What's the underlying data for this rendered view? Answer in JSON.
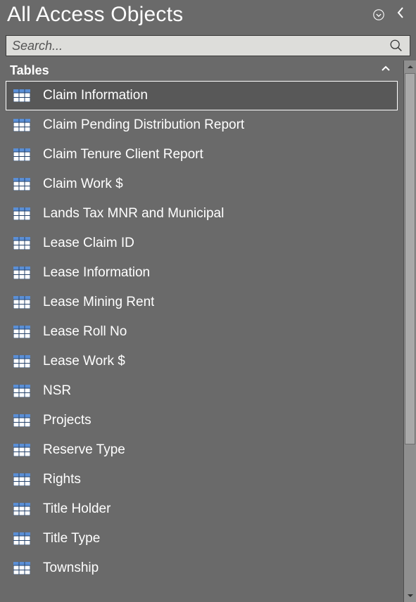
{
  "header": {
    "title": "All Access Objects"
  },
  "search": {
    "placeholder": "Search..."
  },
  "group": {
    "label": "Tables"
  },
  "items": [
    {
      "label": "Claim Information",
      "selected": true
    },
    {
      "label": "Claim Pending Distribution Report",
      "selected": false
    },
    {
      "label": "Claim Tenure Client Report",
      "selected": false
    },
    {
      "label": "Claim Work $",
      "selected": false
    },
    {
      "label": "Lands Tax MNR and Municipal",
      "selected": false
    },
    {
      "label": "Lease Claim ID",
      "selected": false
    },
    {
      "label": "Lease Information",
      "selected": false
    },
    {
      "label": "Lease Mining Rent",
      "selected": false
    },
    {
      "label": "Lease Roll No",
      "selected": false
    },
    {
      "label": "Lease Work $",
      "selected": false
    },
    {
      "label": "NSR",
      "selected": false
    },
    {
      "label": "Projects",
      "selected": false
    },
    {
      "label": "Reserve Type",
      "selected": false
    },
    {
      "label": "Rights",
      "selected": false
    },
    {
      "label": "Title Holder",
      "selected": false
    },
    {
      "label": "Title Type",
      "selected": false
    },
    {
      "label": "Township",
      "selected": false
    }
  ],
  "scrollbar": {
    "thumb_height_pct": 72,
    "thumb_top_pct": 0
  },
  "colors": {
    "bg": "#6a6a6a",
    "searchBg": "#ddddda",
    "selectedBg": "#585858",
    "iconBlue": "#5b8fd6",
    "iconGrid": "#26436b"
  }
}
